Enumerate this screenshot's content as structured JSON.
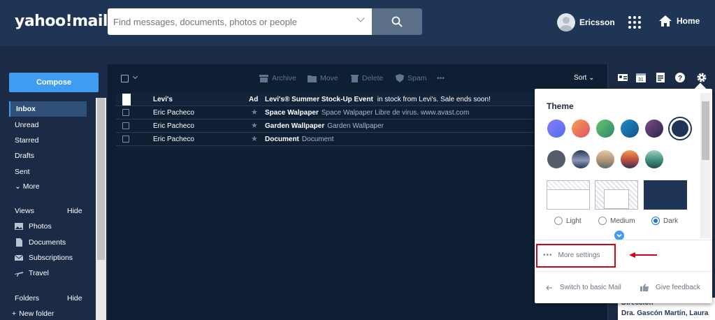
{
  "header": {
    "logo": "yahoo!mail",
    "search_placeholder": "Find messages, documents, photos or people",
    "user_name": "Ericsson",
    "home_label": "Home"
  },
  "sidebar": {
    "compose": "Compose",
    "folders": [
      "Inbox",
      "Unread",
      "Starred",
      "Drafts",
      "Sent"
    ],
    "more": "More",
    "views_title": "Views",
    "views_hide": "Hide",
    "views": [
      "Photos",
      "Documents",
      "Subscriptions",
      "Travel"
    ],
    "folders_title": "Folders",
    "folders_hide": "Hide",
    "new_folder": "New folder"
  },
  "toolbar": {
    "archive": "Archive",
    "move": "Move",
    "delete": "Delete",
    "spam": "Spam",
    "more": "•••",
    "sort": "Sort"
  },
  "messages": [
    {
      "from": "Levi's",
      "ad": "Ad",
      "subject": "Levi's® Summer Stock-Up Event",
      "snippet": "in stock from Levi's. Sale ends soon!"
    },
    {
      "from": "Eric Pacheco",
      "subject": "Space Walpaper",
      "snippet": "Space Walpaper Libre de virus. www.avast.com"
    },
    {
      "from": "Eric Pacheco",
      "subject": "Garden Wallpaper",
      "snippet": "Garden Wallpaper"
    },
    {
      "from": "Eric Pacheco",
      "subject": "Document",
      "snippet": "Document"
    }
  ],
  "settings": {
    "theme_title": "Theme",
    "swatches_row1": [
      "#6b6ff5",
      "#f07a56",
      "#4caf6a",
      "#1677b8",
      "#5a3a72",
      "#1f3556"
    ],
    "swatches_row2": [
      "#555c6a",
      "#3a4a6e",
      "#c9a98a",
      "#e07040",
      "#3f8f7a"
    ],
    "layouts": [
      "Light",
      "Medium",
      "Dark"
    ],
    "selected_layout": "Dark",
    "more_settings": "More settings",
    "switch_basic": "Switch to basic Mail",
    "give_feedback": "Give feedback"
  },
  "rail_preview": {
    "line1": "Dirección",
    "line2": "Dra. Gascón Martín, Laura"
  },
  "colors": {
    "header_bg": "#1f3556",
    "accent": "#3f9cf0",
    "annotation_red": "#d0021b"
  }
}
